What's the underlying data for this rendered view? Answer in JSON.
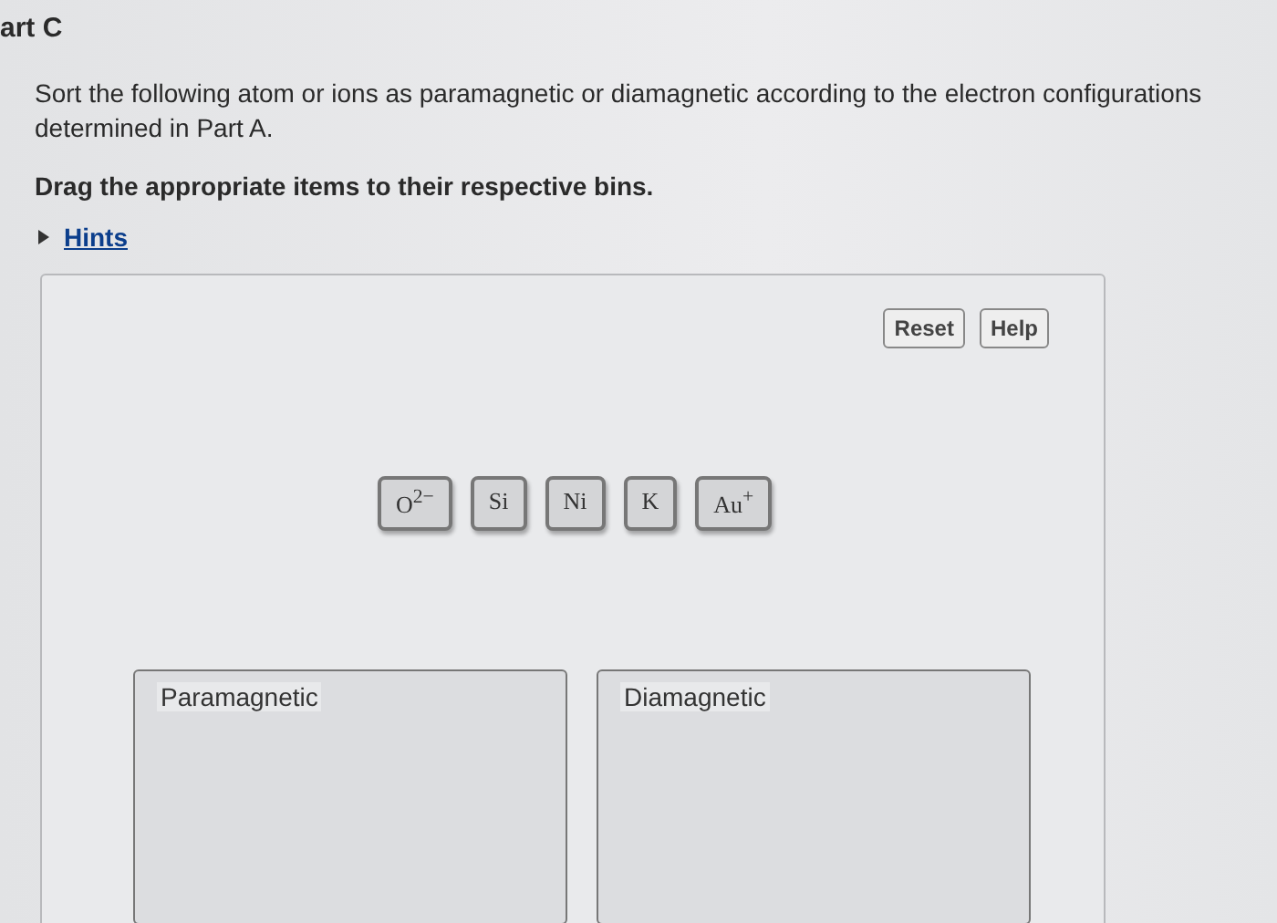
{
  "heading": "art C",
  "instructions": "Sort the following atom or ions as paramagnetic or diamagnetic according to the electron configurations determined in Part A.",
  "task": "Drag the appropriate items to their respective bins.",
  "hints": {
    "label": "Hints",
    "expanded": false
  },
  "buttons": [
    "Reset",
    "Help"
  ],
  "items": [
    "O$^{2−}$",
    "Si",
    "Ni",
    "K",
    "Au$^{+}$"
  ],
  "bins": [
    {
      "label": "Paramagnetic"
    },
    {
      "label": "Diamagnetic"
    }
  ]
}
